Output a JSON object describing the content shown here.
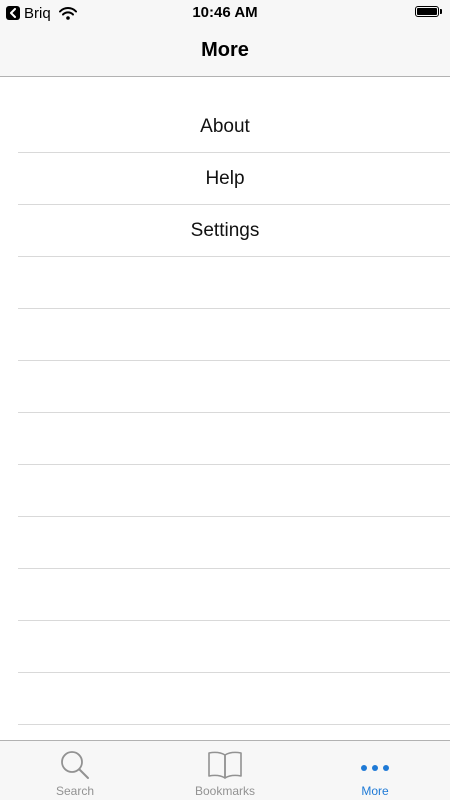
{
  "status_bar": {
    "back_app": "Briq",
    "time": "10:46 AM",
    "battery_level": 1.0
  },
  "nav": {
    "title": "More"
  },
  "list": {
    "items": [
      {
        "label": "About"
      },
      {
        "label": "Help"
      },
      {
        "label": "Settings"
      },
      {
        "label": ""
      },
      {
        "label": ""
      },
      {
        "label": ""
      },
      {
        "label": ""
      },
      {
        "label": ""
      },
      {
        "label": ""
      },
      {
        "label": ""
      },
      {
        "label": ""
      },
      {
        "label": ""
      }
    ]
  },
  "tab_bar": {
    "tabs": [
      {
        "label": "Search",
        "icon": "search-icon",
        "active": false
      },
      {
        "label": "Bookmarks",
        "icon": "book-icon",
        "active": false
      },
      {
        "label": "More",
        "icon": "more-icon",
        "active": true
      }
    ]
  },
  "colors": {
    "accent": "#1f7ad6",
    "inactive": "#929292",
    "bar_background": "#f7f7f7",
    "separator": "#d9d9d9"
  }
}
